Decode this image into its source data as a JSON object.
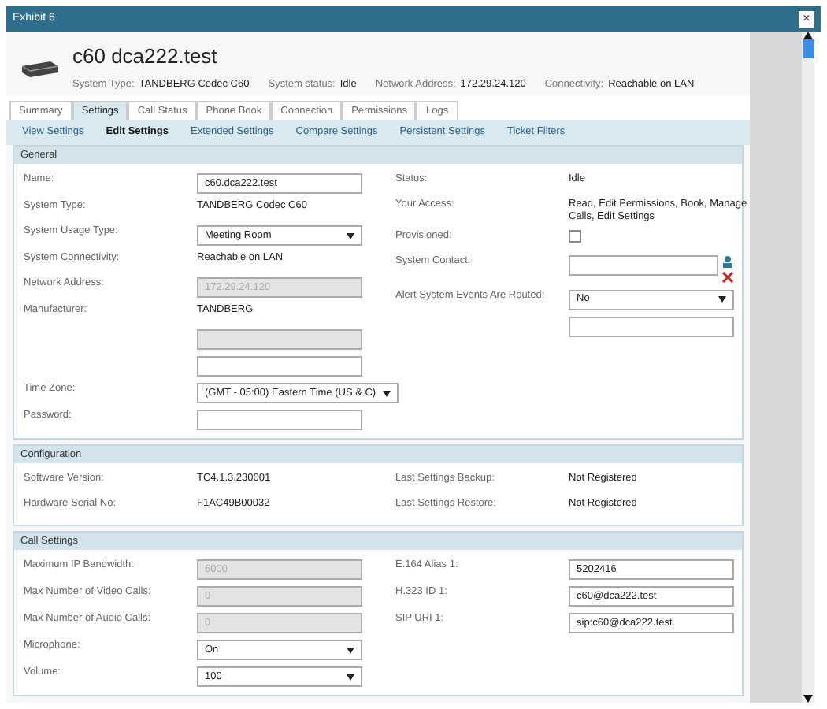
{
  "window": {
    "title": "Exhibit 6",
    "close": "×"
  },
  "device": {
    "name": "c60 dca222.test",
    "info": [
      {
        "label": "System Type:",
        "value": "TANDBERG Codec C60"
      },
      {
        "label": "System status:",
        "value": "Idle"
      },
      {
        "label": "Network Address:",
        "value": "172.29.24.120"
      },
      {
        "label": "Connectivity:",
        "value": "Reachable on LAN"
      }
    ]
  },
  "tabs": [
    {
      "label": "Summary",
      "selected": false
    },
    {
      "label": "Settings",
      "selected": true
    },
    {
      "label": "Call Status",
      "selected": false
    },
    {
      "label": "Phone Book",
      "selected": false
    },
    {
      "label": "Connection",
      "selected": false
    },
    {
      "label": "Permissions",
      "selected": false
    },
    {
      "label": "Logs",
      "selected": false
    }
  ],
  "subtabs": [
    {
      "label": "View Settings",
      "selected": false
    },
    {
      "label": "Edit Settings",
      "selected": true
    },
    {
      "label": "Extended Settings",
      "selected": false
    },
    {
      "label": "Compare Settings",
      "selected": false
    },
    {
      "label": "Persistent Settings",
      "selected": false
    },
    {
      "label": "Ticket Filters",
      "selected": false
    }
  ],
  "sections": [
    {
      "title": "General",
      "left": [
        {
          "kind": "input",
          "label": "Name:",
          "value": "c60.dca222.test",
          "disabled": false
        },
        {
          "kind": "text",
          "label": "System Type:",
          "value": "TANDBERG Codec C60"
        },
        {
          "kind": "select",
          "label": "System Usage Type:",
          "value": "Meeting Room"
        },
        {
          "kind": "text",
          "label": "System Connectivity:",
          "value": "Reachable on LAN"
        },
        {
          "kind": "input",
          "label": "Network Address:",
          "value": "172.29.24.120",
          "disabled": true
        },
        {
          "kind": "text",
          "label": "Manufacturer:",
          "value": "TANDBERG"
        },
        {
          "kind": "input",
          "disabled": true
        },
        {
          "kind": "input",
          "disabled": false
        },
        {
          "kind": "select",
          "label": "Time Zone:",
          "value": "(GMT - 05:00) Eastern Time (US & C)"
        },
        {
          "kind": "input",
          "label": "Password:",
          "disabled": false
        }
      ],
      "right": [
        {
          "kind": "text",
          "label": "Status:",
          "value": "Idle"
        },
        {
          "kind": "text",
          "label": "Your Access:",
          "value": "Read, Edit Permissions, Book, Manage Calls, Edit Settings"
        },
        {
          "kind": "checkbox",
          "label": "Provisioned:",
          "checked": false
        },
        {
          "kind": "contact",
          "label": "System Contact:"
        },
        {
          "kind": "select",
          "label": "Alert System Events Are Routed:",
          "value": "No"
        },
        {
          "kind": "input",
          "disabled": false
        }
      ]
    },
    {
      "title": "Configuration",
      "left": [
        {
          "kind": "text",
          "label": "Software Version:",
          "value": "TC4.1.3.230001"
        },
        {
          "kind": "text",
          "label": "Hardware Serial No:",
          "value": "F1AC49B00032"
        }
      ],
      "right": [
        {
          "kind": "text",
          "label": "Last Settings Backup:",
          "value": "Not Registered"
        },
        {
          "kind": "text",
          "label": "Last Settings Restore:",
          "value": "Not Registered"
        }
      ]
    },
    {
      "title": "Call Settings",
      "left": [
        {
          "kind": "input",
          "label": "Maximum IP Bandwidth:",
          "value": "6000",
          "disabled": true
        },
        {
          "kind": "input",
          "label": "Max Number of Video Calls:",
          "value": "0",
          "disabled": true
        },
        {
          "kind": "input",
          "label": "Max Number of Audio Calls:",
          "value": "0",
          "disabled": true
        },
        {
          "kind": "select",
          "label": "Microphone:",
          "value": "On"
        },
        {
          "kind": "select",
          "label": "Volume:",
          "value": "100"
        }
      ],
      "right": [
        {
          "kind": "input",
          "label": "E.164 Alias 1:",
          "value": "5202416",
          "disabled": false
        },
        {
          "kind": "input",
          "label": "H.323 ID 1:",
          "value": "c60@dca222.test",
          "disabled": false
        },
        {
          "kind": "input",
          "label": "SIP URI 1:",
          "value": "sip:c60@dca222.test",
          "disabled": false
        }
      ]
    }
  ]
}
